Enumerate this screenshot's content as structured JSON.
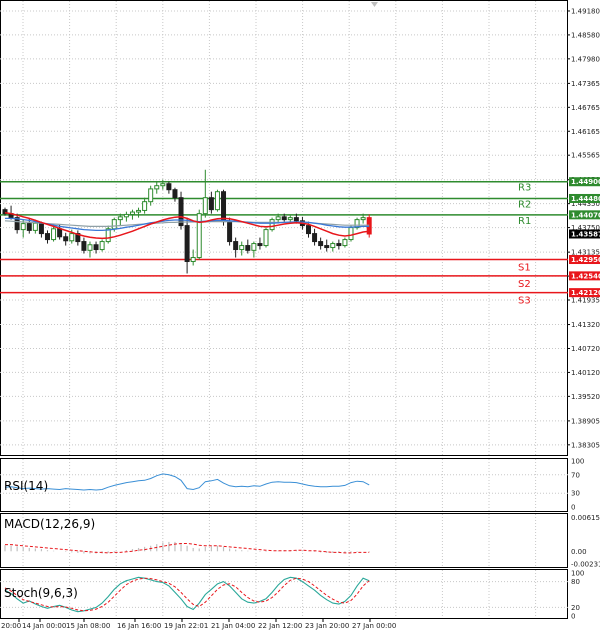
{
  "colors": {
    "green": "#2e8b2e",
    "red": "#e8161b",
    "bull": "#2e8b2e",
    "bear": "#1e1e1e",
    "ma_red": "#e8161b",
    "ma_blue": "#3a78d6",
    "ma_gray": "#8fa0a6",
    "grid": "#c8c8c8",
    "rsi": "#3a8fd6",
    "macd_hist": "#c0c0c0",
    "macd_signal": "#e8161b",
    "stoch_main": "#2aa89a",
    "stoch_signal": "#e8161b",
    "current_badge": "#000000"
  },
  "chart_data": {
    "type": "candlestick",
    "price_axis": {
      "ticks": [
        "1.49180",
        "1.48580",
        "1.47980",
        "1.47365",
        "1.46765",
        "1.46165",
        "1.45565",
        "1.44950",
        "1.44350",
        "1.43750",
        "1.43135",
        "1.42535",
        "1.41935",
        "1.41320",
        "1.40720",
        "1.40120",
        "1.39520",
        "1.38905",
        "1.38305"
      ],
      "ylim": [
        1.3805,
        1.4943
      ]
    },
    "time_axis": {
      "ticks": [
        "20:00",
        "14 Jan 00:00",
        "15 Jan 08:00",
        "16 Jan 16:00",
        "19 Jan 22:01",
        "21 Jan 04:00",
        "22 Jan 12:00",
        "23 Jan 20:00",
        "27 Jan 00:00"
      ]
    },
    "current_price": "1.43587",
    "levels": [
      {
        "name": "R3",
        "value": 1.449,
        "label": "1.44900",
        "kind": "resistance"
      },
      {
        "name": "R2",
        "value": 1.4448,
        "label": "1.44480",
        "kind": "resistance"
      },
      {
        "name": "R1",
        "value": 1.4407,
        "label": "1.44070",
        "kind": "resistance"
      },
      {
        "name": "S1",
        "value": 1.4295,
        "label": "1.42950",
        "kind": "support"
      },
      {
        "name": "S2",
        "value": 1.4254,
        "label": "1.42540",
        "kind": "support"
      },
      {
        "name": "S3",
        "value": 1.4212,
        "label": "1.42120",
        "kind": "support"
      }
    ],
    "candles": [
      [
        1.442,
        1.4425,
        1.4405,
        1.441
      ],
      [
        1.441,
        1.443,
        1.4395,
        1.44
      ],
      [
        1.44,
        1.441,
        1.436,
        1.437
      ],
      [
        1.437,
        1.4395,
        1.435,
        1.4385
      ],
      [
        1.4385,
        1.4398,
        1.436,
        1.4368
      ],
      [
        1.4368,
        1.4395,
        1.436,
        1.4386
      ],
      [
        1.4386,
        1.439,
        1.435,
        1.436
      ],
      [
        1.436,
        1.4368,
        1.4335,
        1.4345
      ],
      [
        1.4345,
        1.438,
        1.434,
        1.4372
      ],
      [
        1.4372,
        1.4382,
        1.4345,
        1.4352
      ],
      [
        1.4352,
        1.4362,
        1.433,
        1.4342
      ],
      [
        1.4342,
        1.437,
        1.4335,
        1.436
      ],
      [
        1.436,
        1.4368,
        1.433,
        1.434
      ],
      [
        1.434,
        1.435,
        1.431,
        1.4318
      ],
      [
        1.4318,
        1.434,
        1.43,
        1.4332
      ],
      [
        1.4332,
        1.434,
        1.431,
        1.432
      ],
      [
        1.432,
        1.4345,
        1.4315,
        1.434
      ],
      [
        1.434,
        1.438,
        1.4335,
        1.4372
      ],
      [
        1.4372,
        1.44,
        1.4365,
        1.4395
      ],
      [
        1.4395,
        1.441,
        1.438,
        1.4402
      ],
      [
        1.4402,
        1.4415,
        1.439,
        1.4408
      ],
      [
        1.4408,
        1.442,
        1.4395,
        1.4414
      ],
      [
        1.4414,
        1.4425,
        1.44,
        1.4418
      ],
      [
        1.4418,
        1.445,
        1.441,
        1.444
      ],
      [
        1.444,
        1.448,
        1.443,
        1.4472
      ],
      [
        1.4472,
        1.449,
        1.446,
        1.448
      ],
      [
        1.448,
        1.4495,
        1.447,
        1.4485
      ],
      [
        1.4485,
        1.449,
        1.446,
        1.447
      ],
      [
        1.447,
        1.4475,
        1.444,
        1.445
      ],
      [
        1.445,
        1.4465,
        1.437,
        1.438
      ],
      [
        1.438,
        1.44,
        1.426,
        1.429
      ],
      [
        1.429,
        1.432,
        1.428,
        1.43
      ],
      [
        1.43,
        1.442,
        1.4295,
        1.441
      ],
      [
        1.441,
        1.452,
        1.44,
        1.445
      ],
      [
        1.445,
        1.4465,
        1.441,
        1.442
      ],
      [
        1.442,
        1.447,
        1.4415,
        1.4465
      ],
      [
        1.4465,
        1.447,
        1.438,
        1.439
      ],
      [
        1.439,
        1.44,
        1.433,
        1.434
      ],
      [
        1.434,
        1.435,
        1.43,
        1.432
      ],
      [
        1.432,
        1.434,
        1.4305,
        1.433
      ],
      [
        1.433,
        1.4345,
        1.431,
        1.4318
      ],
      [
        1.4318,
        1.434,
        1.43,
        1.4335
      ],
      [
        1.4335,
        1.435,
        1.432,
        1.433
      ],
      [
        1.433,
        1.4375,
        1.4325,
        1.437
      ],
      [
        1.437,
        1.44,
        1.4365,
        1.4395
      ],
      [
        1.4395,
        1.441,
        1.4385,
        1.4402
      ],
      [
        1.4402,
        1.441,
        1.439,
        1.4395
      ],
      [
        1.4395,
        1.4405,
        1.4385,
        1.44
      ],
      [
        1.44,
        1.441,
        1.4385,
        1.4392
      ],
      [
        1.4392,
        1.4402,
        1.437,
        1.438
      ],
      [
        1.438,
        1.439,
        1.435,
        1.436
      ],
      [
        1.436,
        1.4372,
        1.433,
        1.434
      ],
      [
        1.434,
        1.435,
        1.432,
        1.433
      ],
      [
        1.433,
        1.4345,
        1.4315,
        1.4325
      ],
      [
        1.4325,
        1.434,
        1.4315,
        1.4335
      ],
      [
        1.4335,
        1.4345,
        1.432,
        1.433
      ],
      [
        1.433,
        1.435,
        1.4325,
        1.4345
      ],
      [
        1.4345,
        1.438,
        1.434,
        1.4375
      ],
      [
        1.4375,
        1.44,
        1.437,
        1.4395
      ],
      [
        1.4395,
        1.441,
        1.4385,
        1.44
      ],
      [
        1.44,
        1.4408,
        1.435,
        1.4359
      ]
    ],
    "ma_red": [
      1.4412,
      1.441,
      1.4406,
      1.4402,
      1.4398,
      1.4393,
      1.4388,
      1.4383,
      1.4378,
      1.4373,
      1.4368,
      1.4363,
      1.4358,
      1.4354,
      1.4351,
      1.4349,
      1.4348,
      1.4349,
      1.4352,
      1.4356,
      1.4361,
      1.4366,
      1.4372,
      1.4378,
      1.4384,
      1.4389,
      1.4394,
      1.4398,
      1.4401,
      1.4402,
      1.4398,
      1.4392,
      1.4388,
      1.439,
      1.4394,
      1.4397,
      1.4398,
      1.4397,
      1.4394,
      1.439,
      1.4386,
      1.4382,
      1.4378,
      1.4377,
      1.4378,
      1.4381,
      1.4384,
      1.4386,
      1.4387,
      1.4386,
      1.4383,
      1.4378,
      1.4372,
      1.4366,
      1.436,
      1.4356,
      1.4354,
      1.4356,
      1.436,
      1.4364,
      1.4366
    ],
    "ma_blue": [
      1.4398,
      1.4398,
      1.4397,
      1.4395,
      1.4393,
      1.439,
      1.4387,
      1.4384,
      1.4381,
      1.4378,
      1.4376,
      1.4374,
      1.4372,
      1.437,
      1.4369,
      1.4368,
      1.4368,
      1.4369,
      1.4371,
      1.4373,
      1.4376,
      1.4378,
      1.4381,
      1.4384,
      1.4387,
      1.4389,
      1.4391,
      1.4393,
      1.4394,
      1.4394,
      1.4393,
      1.4391,
      1.439,
      1.4391,
      1.4392,
      1.4393,
      1.4393,
      1.4392,
      1.4391,
      1.439,
      1.4388,
      1.4387,
      1.4386,
      1.4386,
      1.4386,
      1.4387,
      1.4388,
      1.4389,
      1.4389,
      1.4389,
      1.4388,
      1.4386,
      1.4384,
      1.4381,
      1.4379,
      1.4377,
      1.4376,
      1.4376,
      1.4377,
      1.4378,
      1.4378
    ],
    "ma_gray": [
      1.4392,
      1.4391,
      1.439,
      1.4389,
      1.4388,
      1.4387,
      1.4386,
      1.4385,
      1.4384,
      1.4383,
      1.4382,
      1.4381,
      1.438,
      1.4379,
      1.4378,
      1.4378,
      1.4378,
      1.4378,
      1.4379,
      1.438,
      1.4381,
      1.4382,
      1.4383,
      1.4384,
      1.4385,
      1.4386,
      1.4387,
      1.4388,
      1.4388,
      1.4389,
      1.4389,
      1.4389,
      1.4389,
      1.4389,
      1.439,
      1.439,
      1.439,
      1.439,
      1.439,
      1.4389,
      1.4389,
      1.4388,
      1.4388,
      1.4388,
      1.4388,
      1.4388,
      1.4388,
      1.4388,
      1.4388,
      1.4388,
      1.4387,
      1.4386,
      1.4385,
      1.4384,
      1.4383,
      1.4382,
      1.4381,
      1.4381,
      1.4381,
      1.4381,
      1.4381
    ],
    "rsi": {
      "label": "RSI(14)",
      "ticks": [
        "100",
        "70",
        "30",
        "0"
      ],
      "ylim": [
        0,
        100
      ],
      "values": [
        43,
        44,
        42,
        40,
        41,
        40,
        39,
        40,
        39,
        38,
        40,
        39,
        38,
        37,
        38,
        37,
        38,
        43,
        47,
        50,
        53,
        55,
        57,
        58,
        62,
        68,
        72,
        70,
        66,
        58,
        40,
        38,
        42,
        55,
        57,
        60,
        52,
        46,
        44,
        45,
        44,
        46,
        45,
        50,
        54,
        55,
        54,
        54,
        53,
        50,
        47,
        45,
        44,
        44,
        45,
        45,
        47,
        53,
        56,
        55,
        48
      ]
    },
    "macd": {
      "label": "MACD(12,26,9)",
      "ticks": [
        "0.006151",
        "0.00",
        "-0.002318"
      ],
      "ylim": [
        -0.0023,
        0.0062
      ],
      "hist": [
        0.0011,
        0.001,
        0.0009,
        0.0008,
        0.0006,
        0.0005,
        0.0004,
        0.0002,
        0.0001,
        0.0,
        -0.0001,
        -0.0002,
        -0.0003,
        -0.0004,
        -0.0004,
        -0.0004,
        -0.0004,
        -0.0003,
        -0.0002,
        0.0,
        0.0002,
        0.0004,
        0.0006,
        0.0008,
        0.001,
        0.0013,
        0.0016,
        0.0017,
        0.0017,
        0.0015,
        0.001,
        0.0006,
        0.0005,
        0.0008,
        0.0009,
        0.001,
        0.0008,
        0.0005,
        0.0003,
        0.0002,
        0.0001,
        0.0,
        -0.0001,
        -0.0001,
        0.0,
        0.0001,
        0.0002,
        0.0002,
        0.0002,
        0.0001,
        0.0,
        -0.0001,
        -0.0002,
        -0.0003,
        -0.0003,
        -0.0003,
        -0.0003,
        -0.0002,
        -0.0001,
        0.0,
        -0.0001
      ],
      "signal": [
        0.0012,
        0.0012,
        0.0011,
        0.001,
        0.0009,
        0.0008,
        0.0007,
        0.0006,
        0.0005,
        0.0004,
        0.0003,
        0.0002,
        0.0001,
        0.0,
        -0.0001,
        -0.0002,
        -0.0002,
        -0.0003,
        -0.0002,
        -0.0002,
        -0.0001,
        0.0,
        0.0002,
        0.0003,
        0.0005,
        0.0007,
        0.0009,
        0.0011,
        0.0013,
        0.0014,
        0.0014,
        0.0013,
        0.0011,
        0.001,
        0.001,
        0.001,
        0.0009,
        0.0008,
        0.0007,
        0.0006,
        0.0005,
        0.0004,
        0.0003,
        0.0002,
        0.0001,
        0.0001,
        0.0001,
        0.0001,
        0.0002,
        0.0002,
        0.0001,
        0.0001,
        0.0,
        -0.0001,
        -0.0002,
        -0.0002,
        -0.0003,
        -0.0003,
        -0.0002,
        -0.0002,
        -0.0002
      ]
    },
    "stoch": {
      "label": "Stoch(9,6,3)",
      "ticks": [
        "100",
        "80",
        "20",
        "0"
      ],
      "ylim": [
        0,
        100
      ],
      "main": [
        60,
        52,
        40,
        30,
        35,
        28,
        22,
        18,
        22,
        25,
        20,
        14,
        10,
        12,
        16,
        20,
        30,
        45,
        62,
        75,
        82,
        86,
        90,
        88,
        84,
        80,
        78,
        70,
        55,
        40,
        22,
        15,
        30,
        50,
        62,
        75,
        80,
        70,
        55,
        40,
        32,
        30,
        34,
        40,
        55,
        72,
        85,
        90,
        88,
        80,
        70,
        60,
        48,
        38,
        30,
        28,
        34,
        48,
        70,
        88,
        82
      ],
      "signal": [
        65,
        58,
        48,
        38,
        34,
        30,
        26,
        22,
        21,
        22,
        21,
        18,
        14,
        12,
        13,
        16,
        22,
        32,
        46,
        60,
        73,
        81,
        86,
        88,
        87,
        84,
        80,
        76,
        68,
        55,
        40,
        27,
        22,
        32,
        47,
        62,
        72,
        75,
        68,
        55,
        43,
        35,
        32,
        35,
        43,
        56,
        71,
        83,
        88,
        86,
        80,
        70,
        59,
        48,
        39,
        32,
        30,
        36,
        51,
        70,
        82
      ]
    }
  }
}
